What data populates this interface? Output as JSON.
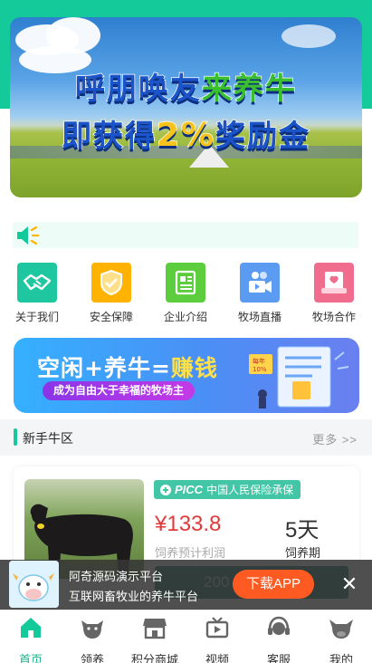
{
  "banner": {
    "line1_a": "呼朋唤友",
    "line1_b": "来养牛",
    "line2_a": "即获得",
    "line2_b": "2%",
    "line2_c": "奖励金"
  },
  "notice": {
    "icon": "speaker-icon",
    "text": ""
  },
  "menu": {
    "items": [
      {
        "label": "关于我们",
        "icon": "handshake-icon",
        "color": "#1fc7a0"
      },
      {
        "label": "安全保障",
        "icon": "shield-icon",
        "color": "#ffb300"
      },
      {
        "label": "企业介绍",
        "icon": "document-icon",
        "color": "#5ccd3c"
      },
      {
        "label": "牧场直播",
        "icon": "live-camera-icon",
        "color": "#5b9cf2"
      },
      {
        "label": "牧场合作",
        "icon": "cooperation-icon",
        "color": "#f06d8e"
      }
    ]
  },
  "promo": {
    "title_a": "空闲+养牛=",
    "title_b": "赚钱",
    "subtitle": "成为自由大于幸福的牧场主",
    "badge1": "每年",
    "badge2": "10%"
  },
  "section": {
    "title": "新手牛区",
    "more": "更多 >>"
  },
  "product": {
    "insurance": "中国人民保险承保",
    "insurance_logo": "PICC",
    "price": "¥133.8",
    "price_label": "饲养预计利润",
    "days": "5天",
    "days_label": "饲养期",
    "partial_value": "200"
  },
  "download": {
    "title": "阿奇源码演示平台",
    "subtitle": "互联网畜牧业的养牛平台",
    "button": "下载APP",
    "close": "✕"
  },
  "tabbar": {
    "items": [
      {
        "label": "首页",
        "icon": "home-icon",
        "active": true
      },
      {
        "label": "领养",
        "icon": "cow-head-icon",
        "active": false
      },
      {
        "label": "积分商城",
        "icon": "shop-icon",
        "active": false
      },
      {
        "label": "视频",
        "icon": "video-icon",
        "active": false
      },
      {
        "label": "客服",
        "icon": "headset-icon",
        "active": false
      },
      {
        "label": "我的",
        "icon": "cow-profile-icon",
        "active": false
      }
    ]
  },
  "colors": {
    "accent": "#14c99a",
    "price": "#e23a3a",
    "download_button": "#ff5a22"
  }
}
